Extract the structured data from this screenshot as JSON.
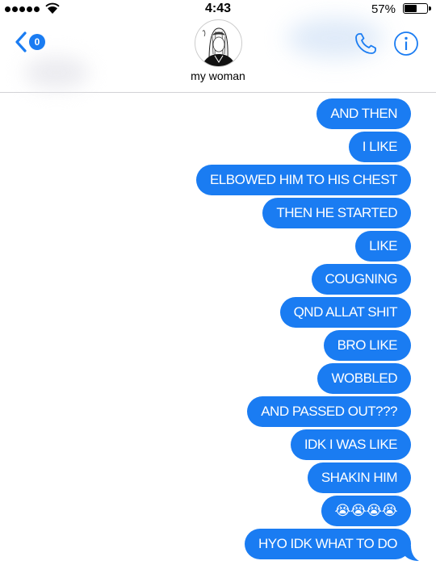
{
  "status_bar": {
    "time": "4:43",
    "battery_percent": "57%",
    "battery_level": 0.57,
    "signal_bars": 5
  },
  "header": {
    "back_badge": "0",
    "contact_name": "my woman",
    "icons": [
      "back-chevron-icon",
      "phone-icon",
      "info-icon"
    ]
  },
  "messages": [
    "AND THEN",
    "I LIKE",
    "ELBOWED HIM TO HIS CHEST",
    "THEN HE STARTED",
    "LIKE",
    "COUGNING",
    "QND ALLAT SHIT",
    "BRO LIKE",
    "WOBBLED",
    "AND PASSED OUT???",
    "IDK I WAS LIKE",
    "SHAKIN HIM",
    "😭😭😭😭",
    "HYO IDK WHAT TO DO"
  ],
  "colors": {
    "bubble_blue": "#1a7cf2",
    "accent": "#1a7cf2",
    "bubble_text": "#ffffff"
  }
}
